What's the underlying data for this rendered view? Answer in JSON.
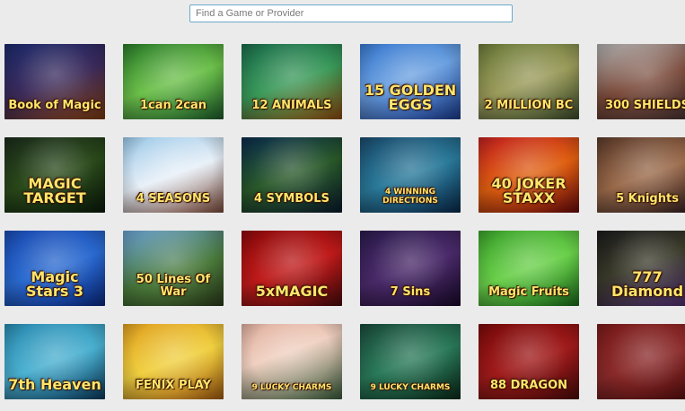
{
  "search": {
    "placeholder": "Find a Game or Provider"
  },
  "games": [
    {
      "title": "Book of Magic",
      "bg": "linear-gradient(160deg,#1c2a6a 0%,#3b2a5a 50%,#7a3a10 100%)"
    },
    {
      "title": "1can 2can",
      "bg": "linear-gradient(160deg,#2a7a2a 0%,#6cc04a 50%,#1d5a2a 100%)"
    },
    {
      "title": "12 ANIMALS",
      "bg": "linear-gradient(160deg,#1a6a4a 0%,#3a9a5a 50%,#8a4a10 100%)"
    },
    {
      "title": "15 GOLDEN EGGS",
      "bg": "linear-gradient(160deg,#3a7ad0 0%,#6aa0e0 45%,#1a3a8a 100%)"
    },
    {
      "title": "2 MILLION BC",
      "bg": "linear-gradient(160deg,#6a7a3a 0%,#9a9a5a 50%,#3a4a2a 100%)"
    },
    {
      "title": "300 SHIELDS",
      "bg": "linear-gradient(160deg,#b0b0b0 0%,#7a4a3a 50%,#3a2a2a 100%)"
    },
    {
      "title": "MAGIC TARGET",
      "bg": "linear-gradient(160deg,#1a2a1a 0%,#2a4a1a 50%,#0a1a0a 100%)"
    },
    {
      "title": "4 SEASONS",
      "bg": "linear-gradient(160deg,#9ac8e8 0%,#e8f0f8 50%,#7a4a3a 100%)"
    },
    {
      "title": "4 SYMBOLS",
      "bg": "linear-gradient(160deg,#0a2a4a 0%,#2a5a2a 50%,#0a1a2a 100%)"
    },
    {
      "title": "4 WINNING DIRECTIONS",
      "bg": "linear-gradient(160deg,#1a4a6a 0%,#2a7a9a 50%,#0a2a4a 100%)"
    },
    {
      "title": "40 JOKER STAXX",
      "bg": "linear-gradient(160deg,#c02020 0%,#e06010 50%,#6a0a0a 100%)"
    },
    {
      "title": "5 Knights",
      "bg": "linear-gradient(160deg,#5a3a2a 0%,#9a6a4a 50%,#2a1a1a 100%)"
    },
    {
      "title": "Magic Stars 3",
      "bg": "linear-gradient(160deg,#1a4ab0 0%,#2a6ad0 50%,#0a2a80 100%)"
    },
    {
      "title": "50 Lines Of War",
      "bg": "linear-gradient(160deg,#6aa0d0 0%,#4a7a3a 55%,#2a3a1a 100%)"
    },
    {
      "title": "5xMAGIC",
      "bg": "linear-gradient(160deg,#8a0a0a 0%,#c01a1a 50%,#4a0a0a 100%)"
    },
    {
      "title": "7 Sins",
      "bg": "linear-gradient(160deg,#2a1a4a 0%,#4a2a6a 50%,#1a0a2a 100%)"
    },
    {
      "title": "Magic Fruits",
      "bg": "linear-gradient(160deg,#3aa02a 0%,#6ad04a 50%,#1a6a1a 100%)"
    },
    {
      "title": "777 Diamond",
      "bg": "linear-gradient(160deg,#1a1a1a 0%,#3a3a2a 45%,#4a2a6a 100%)"
    },
    {
      "title": "7th Heaven",
      "bg": "linear-gradient(160deg,#2a8ab0 0%,#4ab0d0 50%,#0a3a5a 100%)"
    },
    {
      "title": "FENIX PLAY",
      "bg": "linear-gradient(160deg,#e0a020 0%,#f0d040 50%,#a05a10 100%)"
    },
    {
      "title": "9 LUCKY CHARMS",
      "bg": "linear-gradient(160deg,#e0b0a0 0%,#f0d0c0 40%,#3a5a3a 100%)"
    },
    {
      "title": "9 LUCKY CHARMS",
      "bg": "linear-gradient(160deg,#1a4a3a 0%,#2a7a5a 50%,#0a2a1a 100%)"
    },
    {
      "title": "88 DRAGON",
      "bg": "linear-gradient(160deg,#7a0a0a 0%,#a01a1a 50%,#4a0a0a 100%)"
    },
    {
      "title": "",
      "bg": "linear-gradient(160deg,#7a1a1a 0%,#8a2a2a 50%,#4a0a0a 100%)"
    }
  ]
}
